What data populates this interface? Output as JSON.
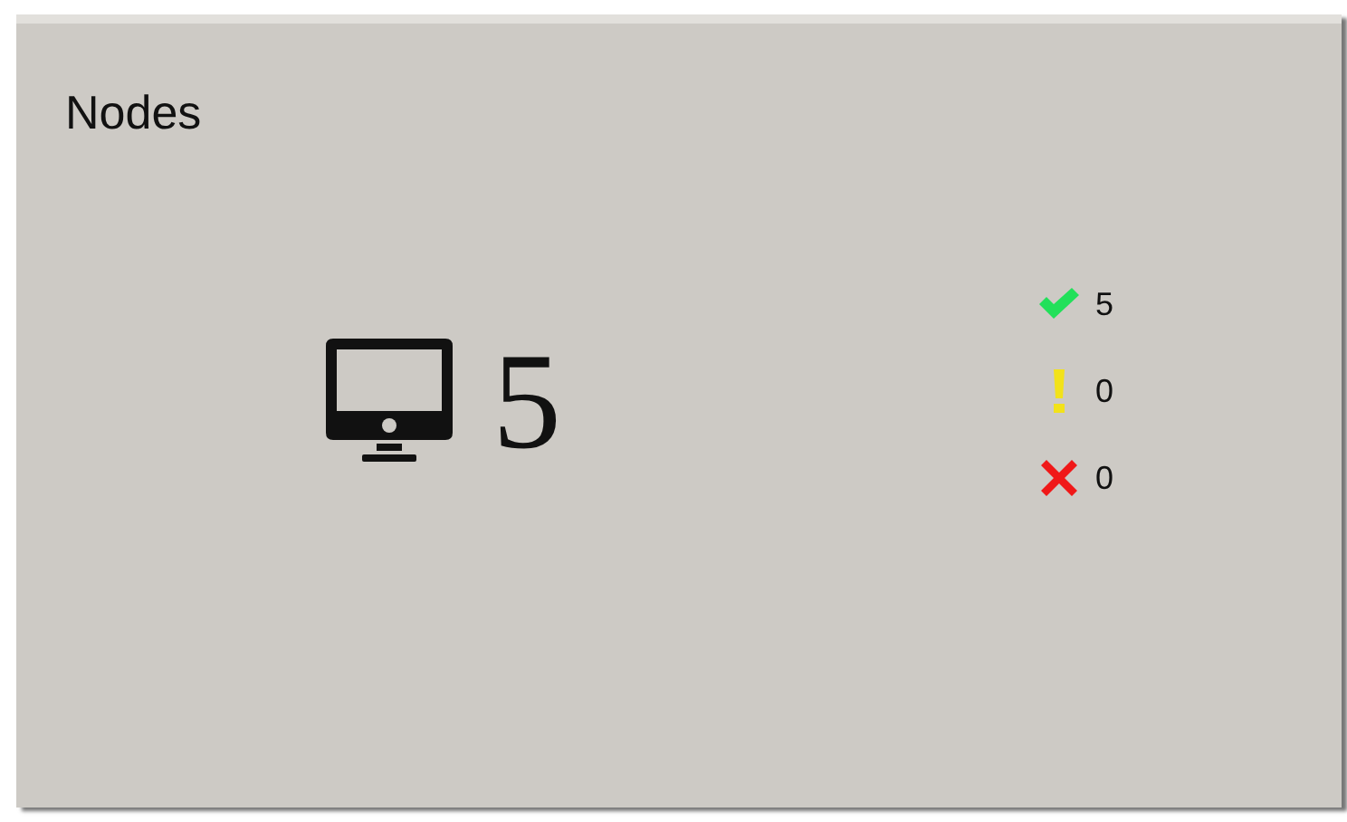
{
  "panel": {
    "title": "Nodes",
    "total": "5"
  },
  "statuses": [
    {
      "kind": "ok",
      "color": "#22e05a",
      "count": "5"
    },
    {
      "kind": "warning",
      "color": "#f2e21a",
      "count": "0"
    },
    {
      "kind": "error",
      "color": "#f01818",
      "count": "0"
    }
  ]
}
